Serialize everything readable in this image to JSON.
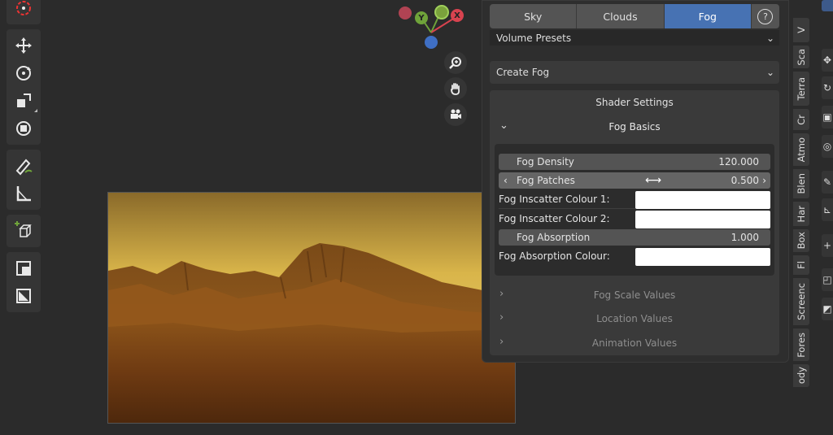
{
  "tabs": [
    {
      "label": "Sky",
      "active": false
    },
    {
      "label": "Clouds",
      "active": false
    },
    {
      "label": "Fog",
      "active": true
    }
  ],
  "help_icon": "question-icon",
  "volume_presets": {
    "label": "Volume Presets"
  },
  "create_fog": {
    "label": "Create Fog"
  },
  "shader_settings": {
    "title": "Shader Settings"
  },
  "fog_basics": {
    "title": "Fog Basics",
    "fog_density": {
      "label": "Fog Density",
      "value": "120.000"
    },
    "fog_patches": {
      "label": "Fog Patches",
      "value": "0.500"
    },
    "inscatter_1": {
      "label": "Fog Inscatter Colour 1:",
      "color": "#ffffff"
    },
    "inscatter_2": {
      "label": "Fog Inscatter Colour 2:",
      "color": "#ffffff"
    },
    "fog_absorption": {
      "label": "Fog Absorption",
      "value": "1.000"
    },
    "absorption_colour": {
      "label": "Fog Absorption Colour:",
      "color": "#ffffff"
    }
  },
  "collapsed_sections": [
    {
      "label": "Fog Scale Values"
    },
    {
      "label": "Location Values"
    },
    {
      "label": "Animation Values"
    }
  ],
  "side_tabs": [
    "V",
    "Sca",
    "Terra",
    "Cr",
    "Atmo",
    "Blen",
    "Har",
    "Box",
    "Fl",
    "Screenc",
    "Fores",
    "ody"
  ],
  "gizmo": {
    "y_label": "Y",
    "x_label": "X"
  },
  "colors": {
    "accent": "#4772b3",
    "x_axis": "#d8434f",
    "y_axis": "#6fa33a",
    "z_axis": "#3f6fc4"
  }
}
